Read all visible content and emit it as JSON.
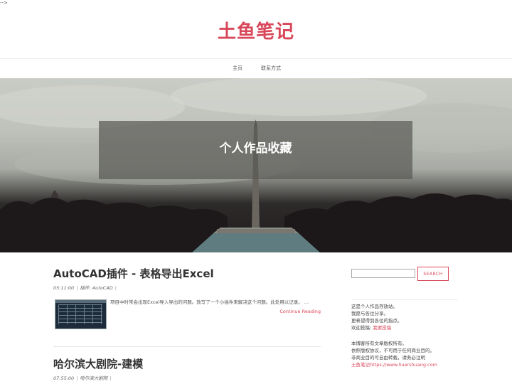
{
  "stray_text": "-->",
  "site": {
    "title": "土鱼笔记"
  },
  "nav": {
    "home": "主页",
    "contact": "联系方式"
  },
  "hero": {
    "title": "个人作品收藏"
  },
  "posts": [
    {
      "title": "AutoCAD插件 - 表格导出Excel",
      "time": "05:11:00",
      "category_prefix": "插件:",
      "category": "AutoCAD",
      "excerpt": "项目中时常会出现Excel导入导出的问题。放写了一个小插件来解决这个问题。此处用以记录。 ...",
      "read_more": "Continue Reading"
    },
    {
      "title": "哈尔滨大剧院-建模",
      "time": "07:55:00",
      "category": "哈尔滨大剧院"
    }
  ],
  "sidebar": {
    "search_placeholder": "",
    "search_button": "SEARCH",
    "about": {
      "line1": "这是个人作品存放站。",
      "line2": "我愿与各位分享。",
      "line3": "更希望得到各位的指点。",
      "line4_prefix": "欢迎投稿:",
      "line4_link": "我要投稿"
    },
    "copyright": {
      "line1": "本博客所有文章版权所有。",
      "line2": "依照版权协议，不可用于任何商业目的。",
      "line3": "非商业目的可自由转载，请务必注明",
      "line4_link": "土鱼笔记https://www.liuershuang.com"
    }
  },
  "colors": {
    "accent": "#d9475a",
    "text": "#333333"
  }
}
